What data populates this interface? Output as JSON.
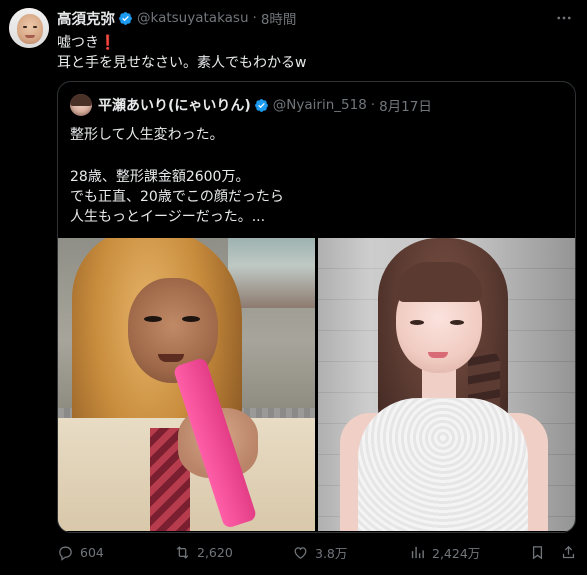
{
  "tweet": {
    "display_name": "高須克弥",
    "handle": "@katsuyatakasu",
    "separator": "·",
    "time": "8時間",
    "line1_prefix": "嘘つき",
    "line1_mark": "❗",
    "line2": "耳と手を見せなさい。素人でもわかるw"
  },
  "quote": {
    "display_name": "平瀬あいり(にゃいりん)",
    "handle": "@Nyairin_518",
    "separator": "·",
    "date": "8月17日",
    "lines": [
      "整形して人生変わった。",
      "28歳、整形課金額2600万。",
      "でも正直、20歳でこの顔だったら",
      "人生もっとイージーだった。..."
    ]
  },
  "actions": {
    "reply_count": "604",
    "retweet_count": "2,620",
    "like_count": "3.8万",
    "views_count": "2,424万"
  },
  "icons": {
    "verified": "verified-badge-icon",
    "more": "more-icon",
    "reply": "reply-icon",
    "retweet": "retweet-icon",
    "like": "heart-icon",
    "views": "views-chart-icon",
    "bookmark": "bookmark-icon",
    "share": "share-icon"
  },
  "colors": {
    "background": "#000000",
    "text": "#e7e9ea",
    "muted": "#71767b",
    "border": "#2f3336",
    "verified_blue": "#1d9bf0",
    "exclaim_red": "#e0245e"
  }
}
